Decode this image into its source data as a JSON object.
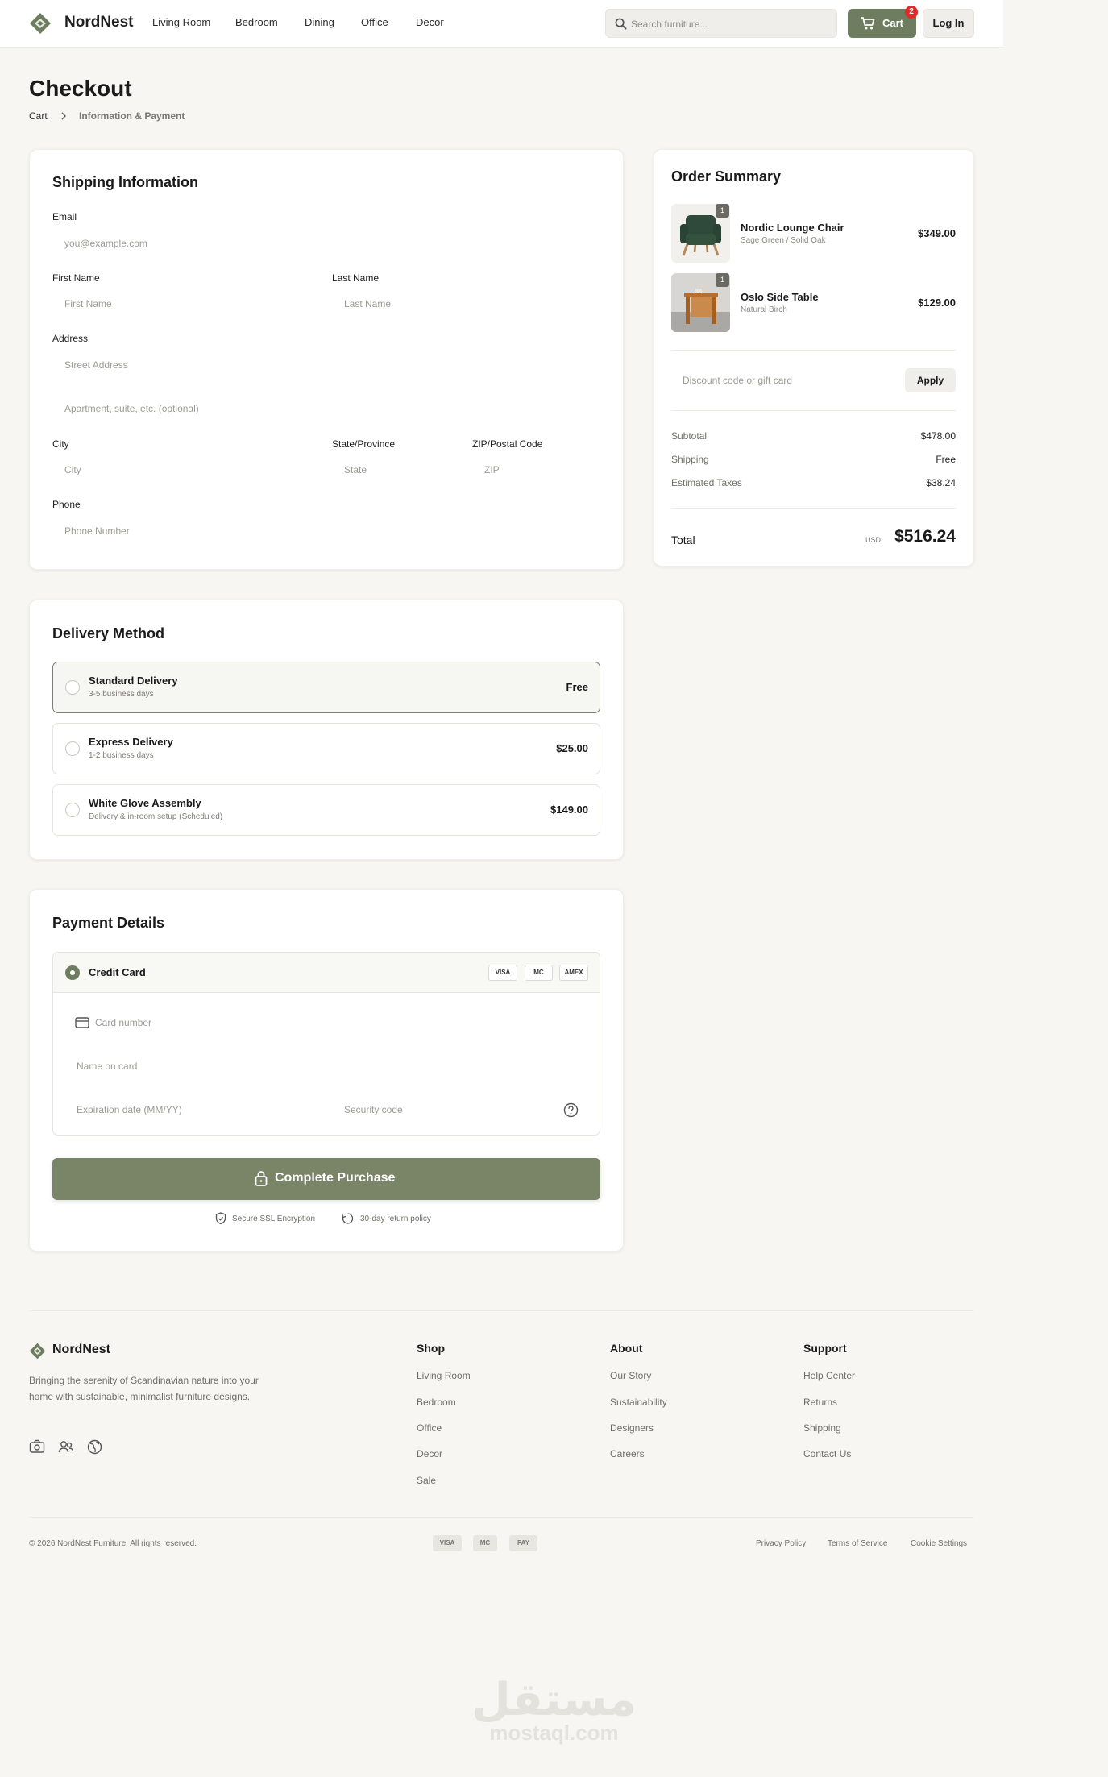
{
  "header": {
    "brand": "NordNest",
    "nav": [
      "Living Room",
      "Bedroom",
      "Dining",
      "Office",
      "Decor"
    ],
    "search_placeholder": "Search furniture...",
    "cart_label": "Cart",
    "cart_count": "2",
    "login_label": "Log In"
  },
  "page": {
    "title": "Checkout",
    "breadcrumb": {
      "cart": "Cart",
      "current": "Information & Payment"
    }
  },
  "shipping": {
    "title": "Shipping Information",
    "email_label": "Email",
    "email_placeholder": "you@example.com",
    "first_name_label": "First Name",
    "first_name_placeholder": "First Name",
    "last_name_label": "Last Name",
    "last_name_placeholder": "Last Name",
    "address_label": "Address",
    "street_placeholder": "Street Address",
    "apt_placeholder": "Apartment, suite, etc. (optional)",
    "city_label": "City",
    "city_placeholder": "City",
    "state_label": "State/Province",
    "state_placeholder": "State",
    "zip_label": "ZIP/Postal Code",
    "zip_placeholder": "ZIP",
    "phone_label": "Phone",
    "phone_placeholder": "Phone Number"
  },
  "delivery": {
    "title": "Delivery Method",
    "options": [
      {
        "title": "Standard Delivery",
        "sub": "3-5 business days",
        "price": "Free"
      },
      {
        "title": "Express Delivery",
        "sub": "1-2 business days",
        "price": "$25.00"
      },
      {
        "title": "White Glove Assembly",
        "sub": "Delivery & in-room setup (Scheduled)",
        "price": "$149.00"
      }
    ]
  },
  "payment": {
    "title": "Payment Details",
    "method": "Credit Card",
    "cards": [
      "VISA",
      "MC",
      "AMEX"
    ],
    "card_number_placeholder": "Card number",
    "name_placeholder": "Name on card",
    "expiry_placeholder": "Expiration date (MM/YY)",
    "cvc_placeholder": "Security code",
    "complete_label": "Complete Purchase",
    "ssl_note": "Secure SSL Encryption",
    "return_note": "30-day return policy"
  },
  "summary": {
    "title": "Order Summary",
    "items": [
      {
        "name": "Nordic Lounge Chair",
        "variant": "Sage Green / Solid Oak",
        "qty": "1",
        "price": "$349.00"
      },
      {
        "name": "Oslo Side Table",
        "variant": "Natural Birch",
        "qty": "1",
        "price": "$129.00"
      }
    ],
    "discount_placeholder": "Discount code or gift card",
    "apply_label": "Apply",
    "subtotal_label": "Subtotal",
    "subtotal": "$478.00",
    "shipping_label": "Shipping",
    "shipping": "Free",
    "taxes_label": "Estimated Taxes",
    "taxes": "$38.24",
    "total_label": "Total",
    "currency": "USD",
    "total": "$516.24"
  },
  "footer": {
    "brand": "NordNest",
    "tagline": "Bringing the serenity of Scandinavian nature into your home with sustainable, minimalist furniture designs.",
    "columns": [
      {
        "title": "Shop",
        "links": [
          "Living Room",
          "Bedroom",
          "Office",
          "Decor",
          "Sale"
        ]
      },
      {
        "title": "About",
        "links": [
          "Our Story",
          "Sustainability",
          "Designers",
          "Careers"
        ]
      },
      {
        "title": "Support",
        "links": [
          "Help Center",
          "Returns",
          "Shipping",
          "Contact Us"
        ]
      }
    ],
    "copyright": "© 2026 NordNest Furniture. All rights reserved.",
    "pay_chips": [
      "VISA",
      "MC",
      "PAY"
    ],
    "legal": [
      "Privacy Policy",
      "Terms of Service",
      "Cookie Settings"
    ]
  },
  "watermark": {
    "arabic": "مستقل",
    "latin": "mostaql.com"
  },
  "colors": {
    "accent": "#6e7d5f",
    "button": "#7a8568",
    "background": "#f7f6f2",
    "badge": "#e02b2b"
  }
}
